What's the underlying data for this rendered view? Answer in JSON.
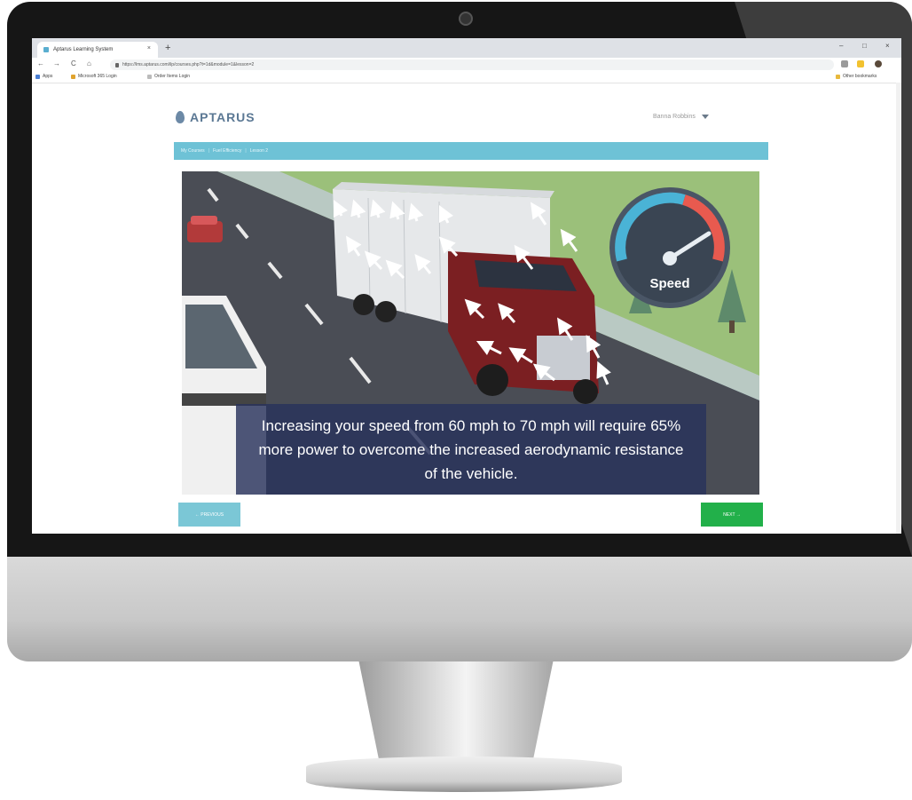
{
  "browser": {
    "tab_title": "Aptarus Learning System",
    "tab_close": "×",
    "new_tab": "+",
    "window_controls": {
      "minimize": "–",
      "maximize": "□",
      "close": "×"
    },
    "nav": {
      "back": "←",
      "forward": "→",
      "reload": "C",
      "home": "⌂"
    },
    "url": "https://lms.aptarus.com/ilp/courses.php?t=1d&module=1&lesson=2",
    "bookmarks": [
      "Apps",
      "Microsoft 365 Login",
      "Order Items Login"
    ],
    "other_bookmarks": "Other bookmarks",
    "colors": {
      "tabbar": "#dee1e6",
      "omnibox": "#f1f3f4"
    }
  },
  "app": {
    "logo_text": "APTARUS",
    "user_name": "Banna Robbins",
    "breadcrumb": [
      "My Courses",
      "Fuel Efficiency",
      "Lesson 2"
    ],
    "caption": "Increasing your speed from 60 mph to 70 mph will require 65% more power to overcome the increased aerodynamic resistance of the vehicle.",
    "gauge_label": "Speed",
    "prev_label": "← PREVIOUS",
    "next_label": "NEXT →",
    "colors": {
      "breadcrumb_bar": "#6ec2d6",
      "logo": "#5b7894",
      "next_button": "#22b04a",
      "prev_button": "#7bc7d6",
      "caption_bg": "#28325c"
    }
  }
}
